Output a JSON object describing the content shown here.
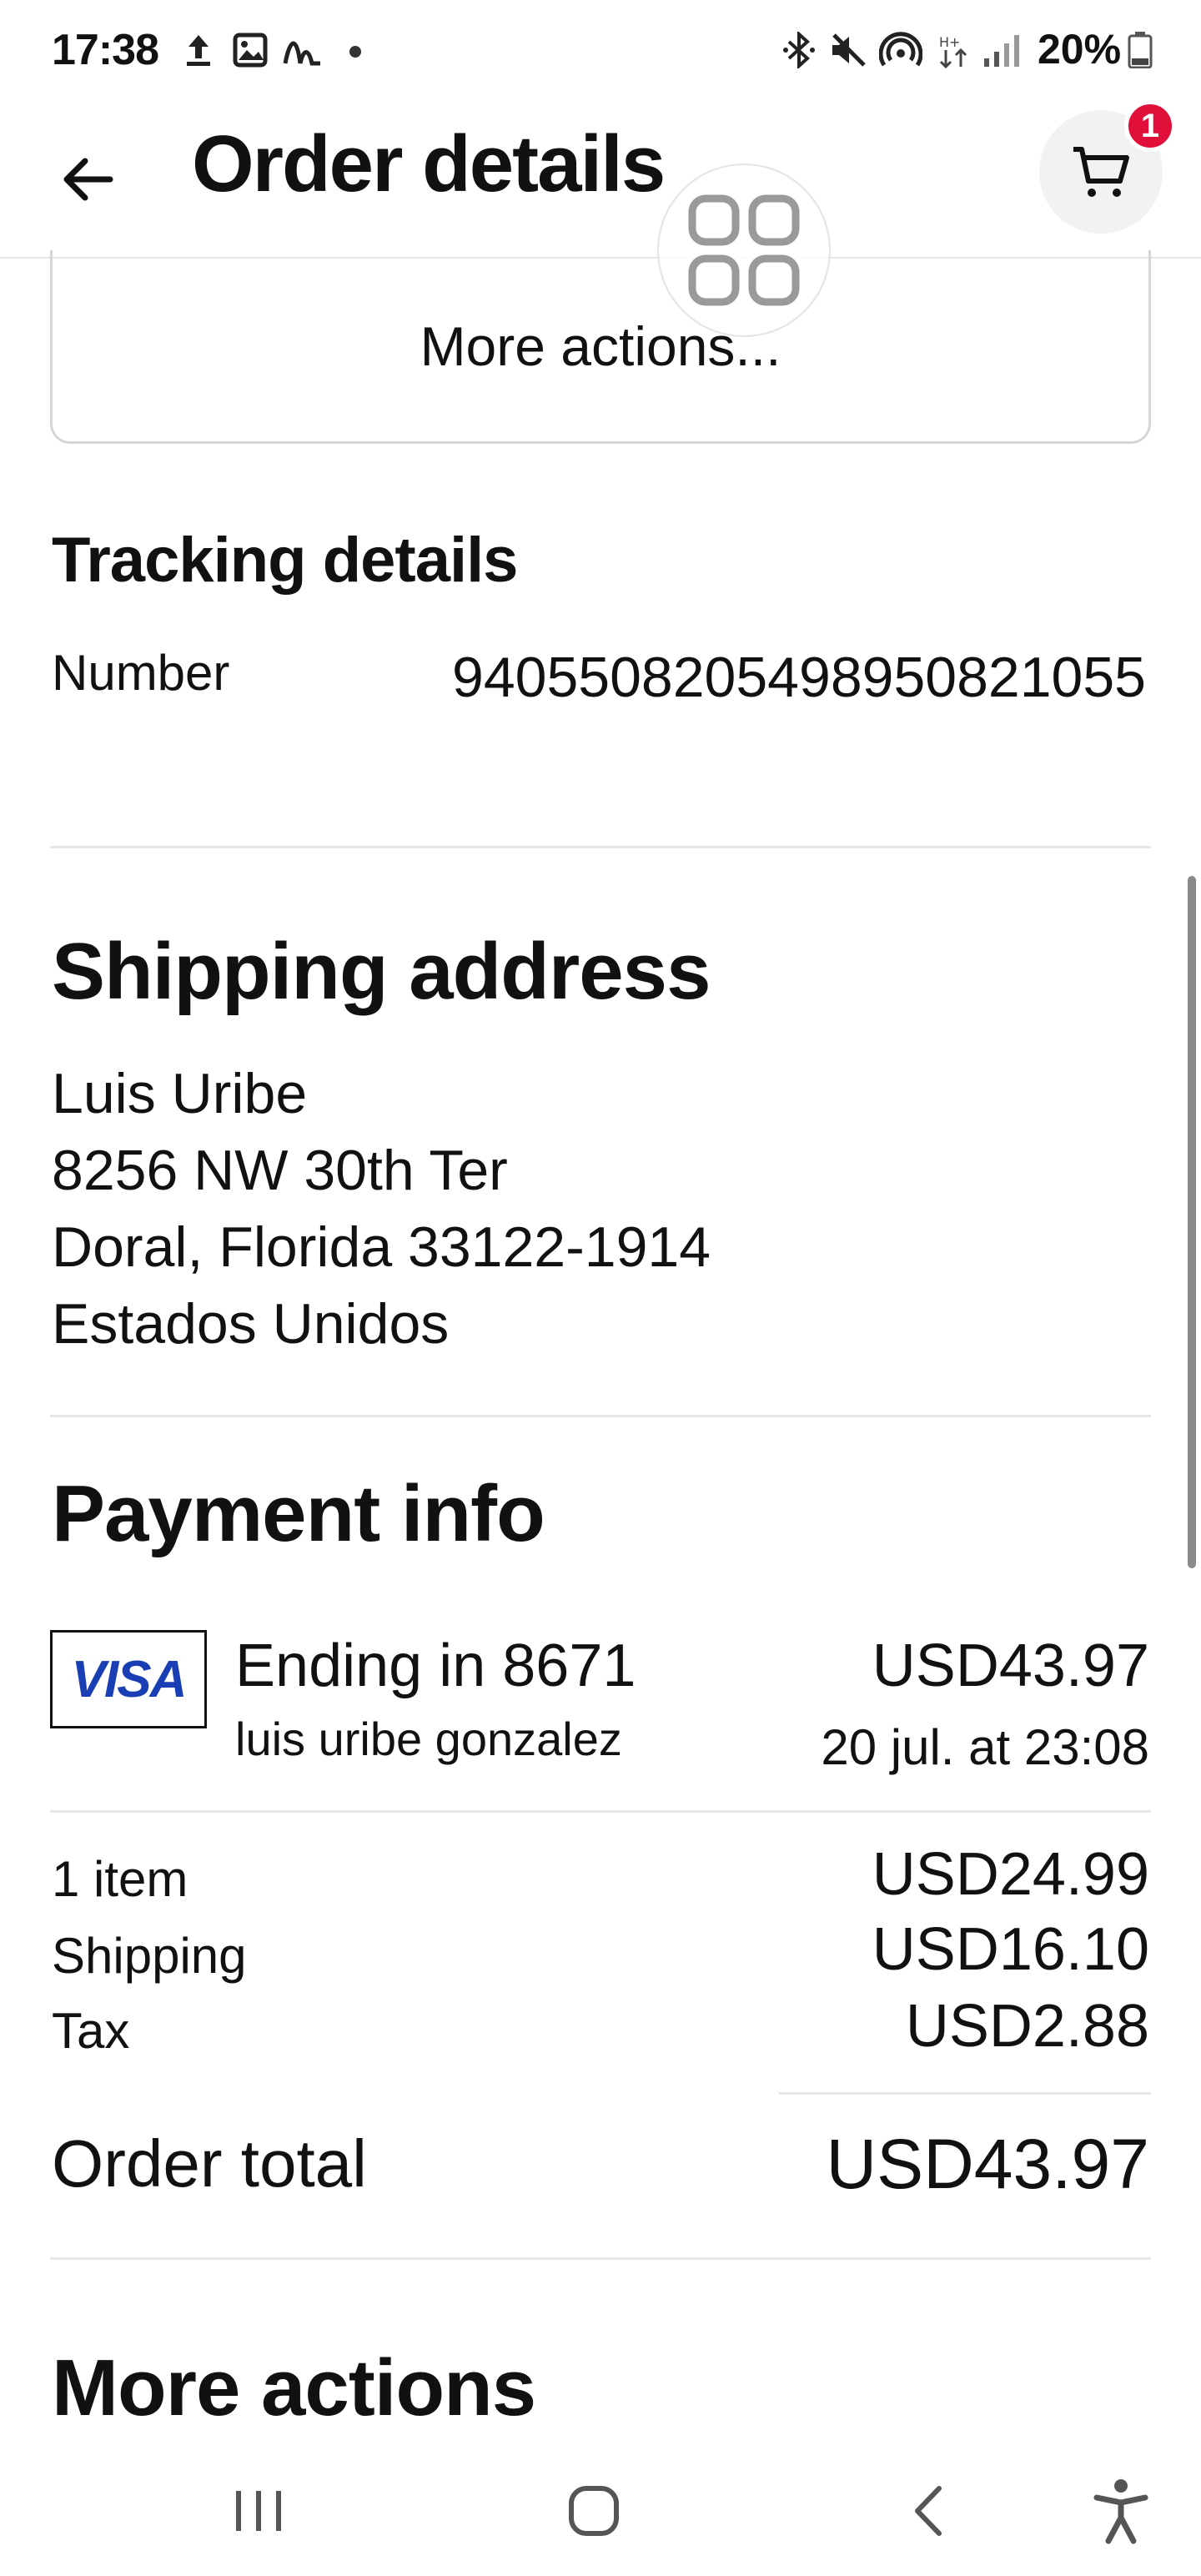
{
  "status_bar": {
    "time": "17:38",
    "battery": "20%",
    "left_icons": [
      "upload-icon",
      "image-icon",
      "signal-wave-icon",
      "dot-icon"
    ],
    "right_icons": [
      "bluetooth-icon",
      "mute-icon",
      "hotspot-icon",
      "data-arrows-icon",
      "cell-signal-icon",
      "battery-icon"
    ]
  },
  "header": {
    "title": "Order details",
    "cart_badge": "1"
  },
  "top_card": {
    "label": "More actions..."
  },
  "tracking": {
    "title": "Tracking details",
    "number_label": "Number",
    "number_value": "9405508205498950821055"
  },
  "shipping": {
    "title": "Shipping address",
    "lines": [
      "Luis Uribe",
      "8256 NW 30th Ter",
      "Doral, Florida 33122-1914",
      "Estados Unidos"
    ]
  },
  "payment": {
    "title": "Payment info",
    "card_brand": "VISA",
    "card_ending": "Ending in 8671",
    "card_holder": "luis uribe gonzalez",
    "amount": "USD43.97",
    "date": "20 jul. at 23:08",
    "brand_color": "#1a3fb5"
  },
  "summary": {
    "rows": [
      {
        "label": "1 item",
        "value": "USD24.99"
      },
      {
        "label": "Shipping",
        "value": "USD16.10"
      },
      {
        "label": "Tax",
        "value": "USD2.88"
      }
    ],
    "total_label": "Order total",
    "total_value": "USD43.97"
  },
  "more_actions_title": "More actions",
  "colors": {
    "badge": "#e0103a",
    "text": "#111111",
    "divider": "#e6e6e6"
  }
}
